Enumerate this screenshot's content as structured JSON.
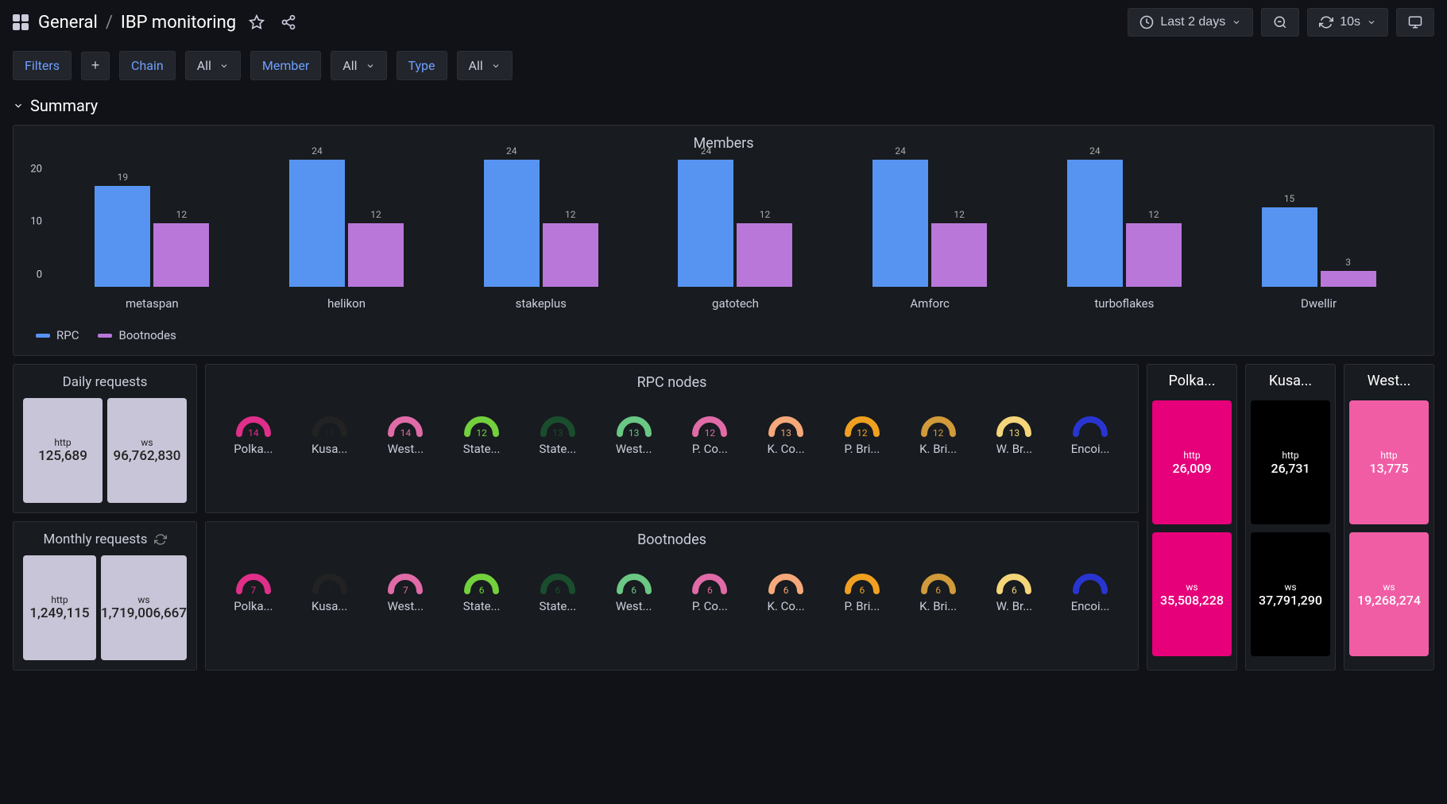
{
  "header": {
    "breadcrumb_folder": "General",
    "breadcrumb_dash": "IBP monitoring",
    "time_range": "Last 2 days",
    "refresh_interval": "10s"
  },
  "filters": {
    "filters_label": "Filters",
    "chain_label": "Chain",
    "chain_value": "All",
    "member_label": "Member",
    "member_value": "All",
    "type_label": "Type",
    "type_value": "All"
  },
  "summary_title": "Summary",
  "chart_data": {
    "type": "bar",
    "title": "Members",
    "xlabel": "",
    "ylabel": "",
    "ylim": [
      0,
      24
    ],
    "y_ticks": [
      "0",
      "10",
      "20"
    ],
    "categories": [
      "metaspan",
      "helikon",
      "stakeplus",
      "gatotech",
      "Amforc",
      "turboflakes",
      "Dwellir"
    ],
    "series": [
      {
        "name": "RPC",
        "values": [
          19,
          24,
          24,
          24,
          24,
          24,
          15
        ],
        "color": "#5794f2"
      },
      {
        "name": "Bootnodes",
        "values": [
          12,
          12,
          12,
          12,
          12,
          12,
          3
        ],
        "color": "#b877d9"
      }
    ]
  },
  "daily_requests": {
    "title": "Daily requests",
    "http_label": "http",
    "http_value": "125,689",
    "ws_label": "ws",
    "ws_value": "96,762,830"
  },
  "monthly_requests": {
    "title": "Monthly requests",
    "http_label": "http",
    "http_value": "1,249,115",
    "ws_label": "ws",
    "ws_value": "1,719,006,667"
  },
  "rpc_nodes": {
    "title": "RPC nodes",
    "items": [
      {
        "label": "Polka...",
        "value": "14",
        "color": "#e02f8a"
      },
      {
        "label": "Kusa...",
        "value": "14",
        "color": "#222222"
      },
      {
        "label": "West...",
        "value": "14",
        "color": "#e06ba7"
      },
      {
        "label": "State...",
        "value": "12",
        "color": "#73d13d"
      },
      {
        "label": "State...",
        "value": "13",
        "color": "#1a4d2e"
      },
      {
        "label": "West...",
        "value": "13",
        "color": "#6ac784"
      },
      {
        "label": "P. Co...",
        "value": "12",
        "color": "#e06ba7"
      },
      {
        "label": "K. Co...",
        "value": "13",
        "color": "#f5a87a"
      },
      {
        "label": "P. Bri...",
        "value": "12",
        "color": "#f0a020"
      },
      {
        "label": "K. Bri...",
        "value": "12",
        "color": "#d19a3a"
      },
      {
        "label": "W. Br...",
        "value": "13",
        "color": "#f5d57a"
      },
      {
        "label": "Encoi...",
        "value": "",
        "color": "#2935d0"
      }
    ]
  },
  "bootnodes": {
    "title": "Bootnodes",
    "items": [
      {
        "label": "Polka...",
        "value": "7",
        "color": "#e02f8a"
      },
      {
        "label": "Kusa...",
        "value": "7",
        "color": "#222222"
      },
      {
        "label": "West...",
        "value": "7",
        "color": "#e06ba7"
      },
      {
        "label": "State...",
        "value": "6",
        "color": "#73d13d"
      },
      {
        "label": "State...",
        "value": "6",
        "color": "#1a4d2e"
      },
      {
        "label": "West...",
        "value": "6",
        "color": "#6ac784"
      },
      {
        "label": "P. Co...",
        "value": "6",
        "color": "#e06ba7"
      },
      {
        "label": "K. Co...",
        "value": "6",
        "color": "#f5a87a"
      },
      {
        "label": "P. Bri...",
        "value": "6",
        "color": "#f0a020"
      },
      {
        "label": "K. Bri...",
        "value": "6",
        "color": "#d19a3a"
      },
      {
        "label": "W. Br...",
        "value": "6",
        "color": "#f5d57a"
      },
      {
        "label": "Encoi...",
        "value": "",
        "color": "#2935d0"
      }
    ]
  },
  "chains": [
    {
      "title": "Polka...",
      "http_label": "http",
      "http_value": "26,009",
      "ws_label": "ws",
      "ws_value": "35,508,228",
      "bg": "#e6007a"
    },
    {
      "title": "Kusa...",
      "http_label": "http",
      "http_value": "26,731",
      "ws_label": "ws",
      "ws_value": "37,791,290",
      "bg": "#000000"
    },
    {
      "title": "West...",
      "http_label": "http",
      "http_value": "13,775",
      "ws_label": "ws",
      "ws_value": "19,268,274",
      "bg": "#f05da5"
    }
  ]
}
